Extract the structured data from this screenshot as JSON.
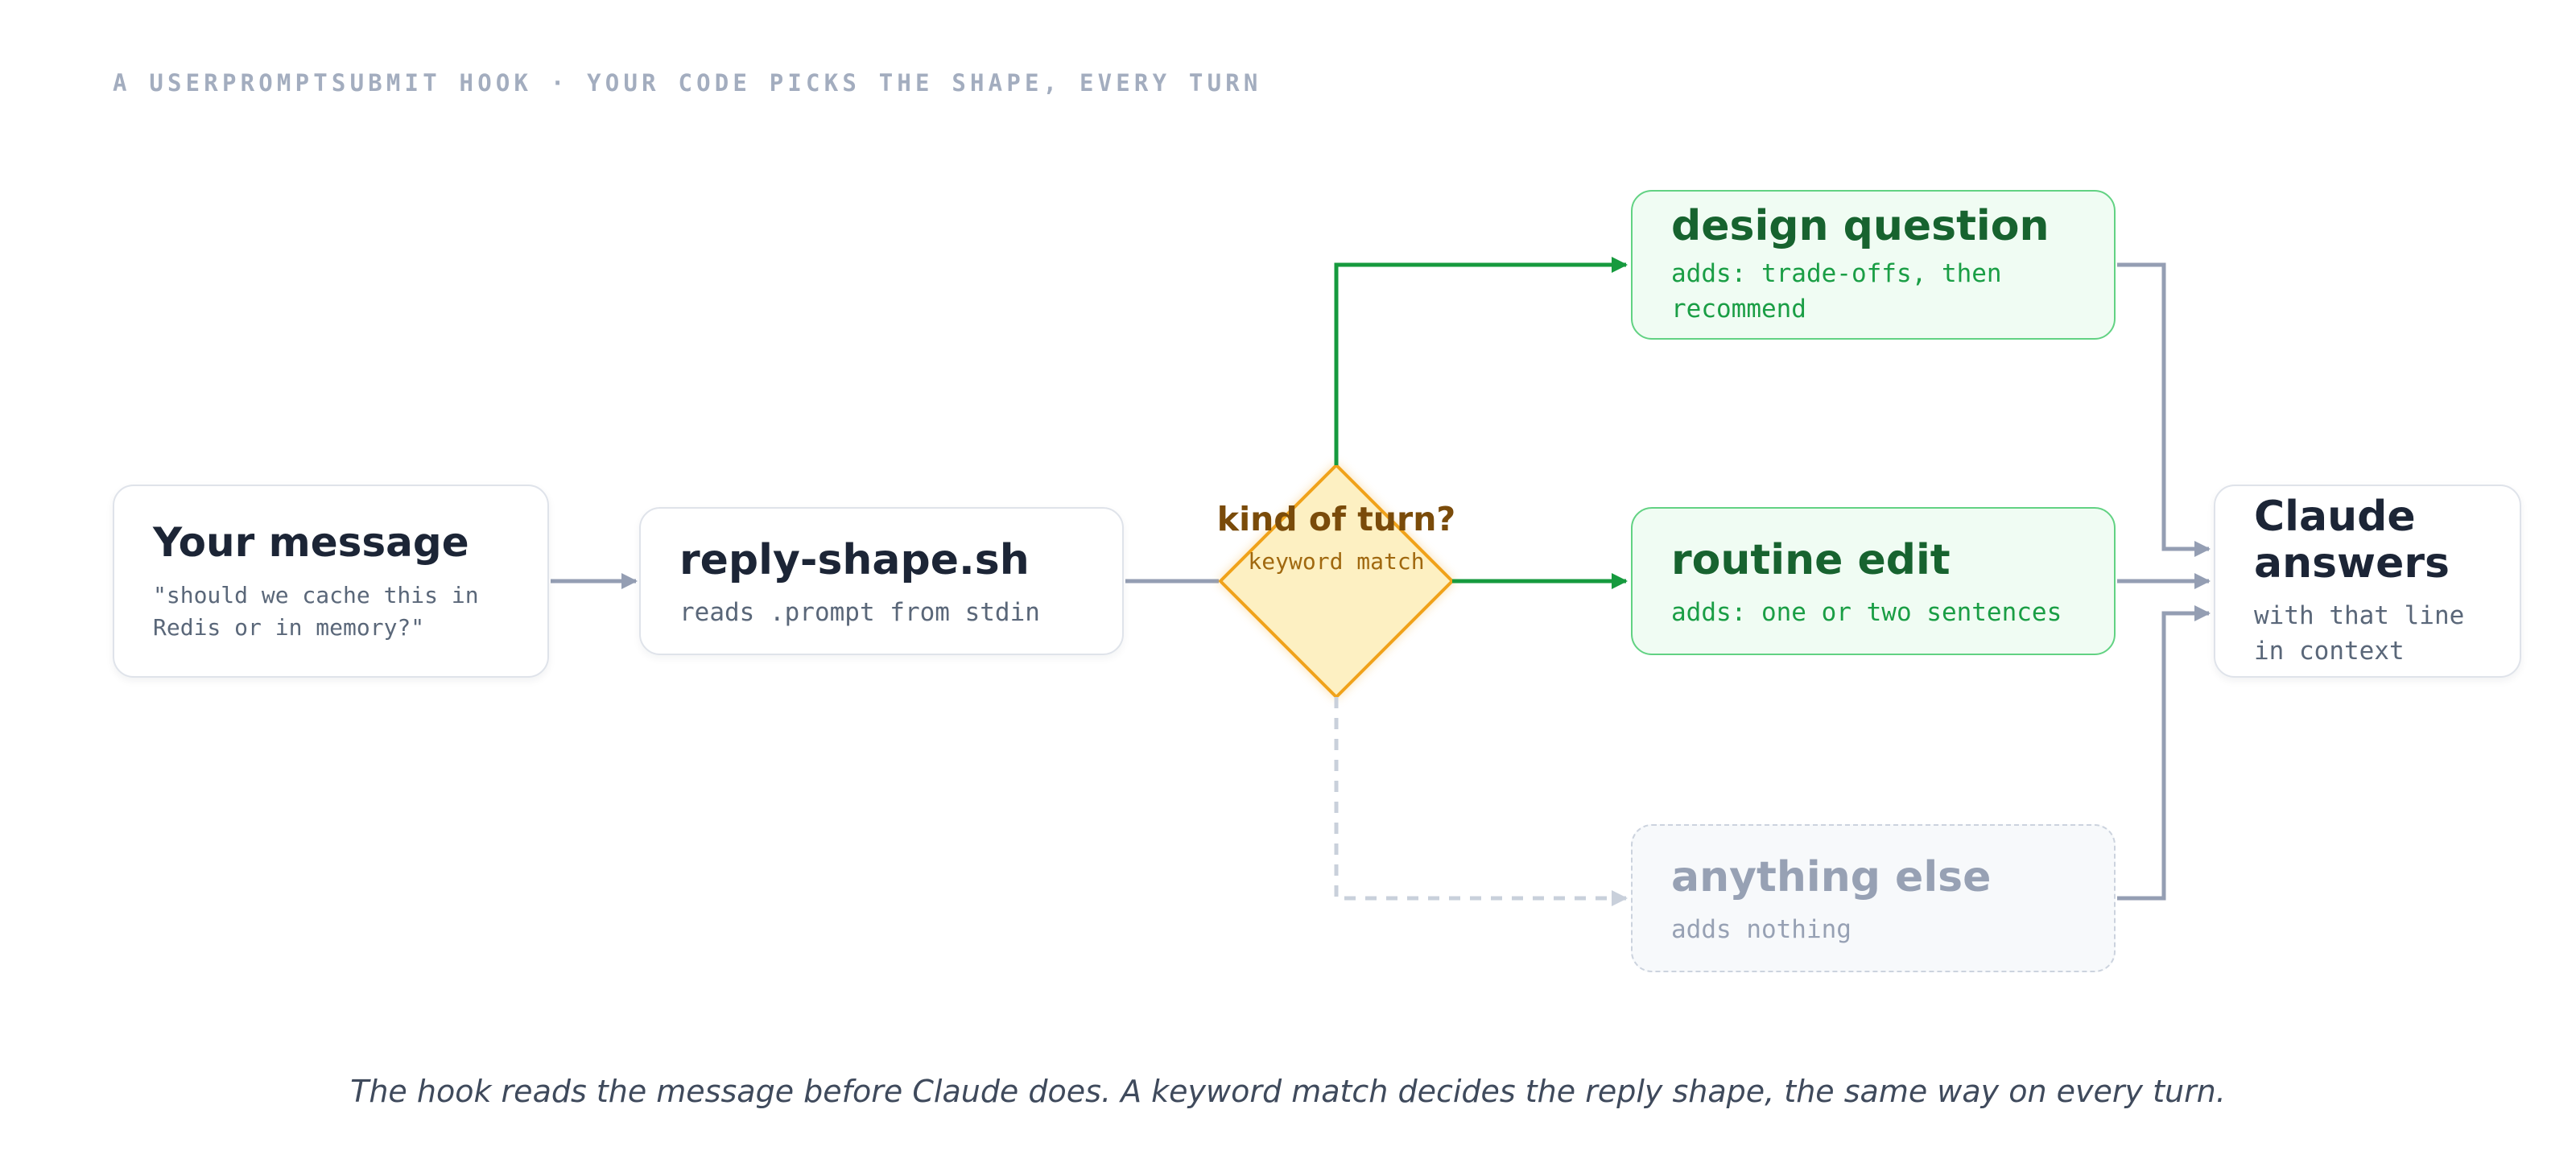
{
  "header": {
    "eyebrow": "A USERPROMPTSUBMIT HOOK · YOUR CODE PICKS THE SHAPE, EVERY TURN"
  },
  "nodes": {
    "message": {
      "title": "Your message",
      "subtitle": "\"should we cache this in Redis or in memory?\""
    },
    "script": {
      "title": "reply-shape.sh",
      "subtitle": "reads .prompt from stdin"
    },
    "decision": {
      "title": "kind of turn?",
      "subtitle": "keyword match"
    },
    "design": {
      "title": "design question",
      "subtitle": "adds: trade-offs, then recommend"
    },
    "routine": {
      "title": "routine edit",
      "subtitle": "adds: one or two sentences"
    },
    "other": {
      "title": "anything else",
      "subtitle": "adds nothing"
    },
    "claude": {
      "title": "Claude answers",
      "subtitle": "with that line in context"
    }
  },
  "caption": "The hook reads the message before Claude does. A keyword match decides the reply shape, the same way on every turn.",
  "colors": {
    "active_path": "#169a3e",
    "neutral_path": "#949eb3",
    "inactive_path": "#c9d0db",
    "decision_fill": "#fdf0c2",
    "decision_stroke": "#f0a21a"
  }
}
